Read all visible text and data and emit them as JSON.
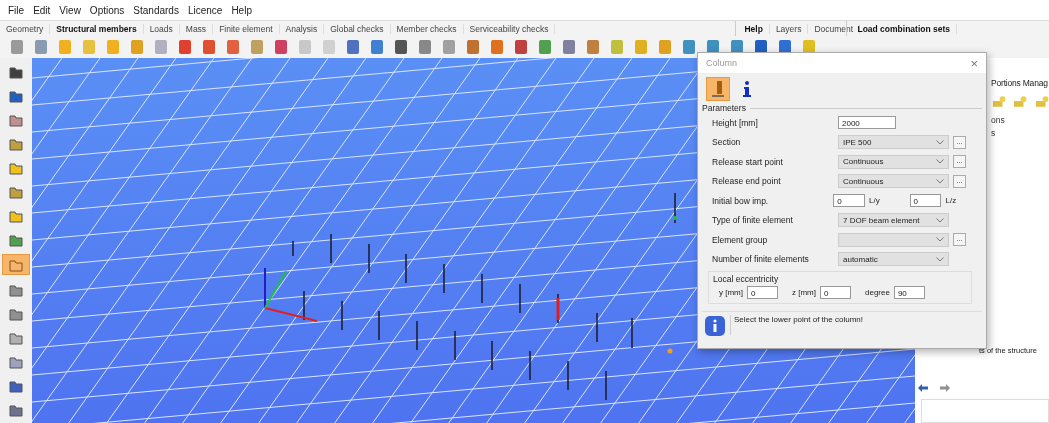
{
  "menu": [
    "File",
    "Edit",
    "View",
    "Options",
    "Standards",
    "Licence",
    "Help"
  ],
  "tabs": [
    {
      "label": "Geometry",
      "selected": false
    },
    {
      "label": "Structural members",
      "selected": true
    },
    {
      "label": "Loads",
      "selected": false
    },
    {
      "label": "Mass",
      "selected": false
    },
    {
      "label": "Finite element",
      "selected": false
    },
    {
      "label": "Analysis",
      "selected": false
    },
    {
      "label": "Global checks",
      "selected": false
    },
    {
      "label": "Member checks",
      "selected": false
    },
    {
      "label": "Serviceability checks",
      "selected": false
    }
  ],
  "help_tabs": [
    {
      "label": "Help",
      "selected": true
    },
    {
      "label": "Layers",
      "selected": false
    },
    {
      "label": "Document",
      "selected": false
    }
  ],
  "combination_tab": {
    "label": "Load combination sets",
    "selected": true
  },
  "left_toolbar": [
    {
      "selected": false
    },
    {
      "selected": false
    },
    {
      "selected": false
    },
    {
      "selected": false
    },
    {
      "selected": false
    },
    {
      "selected": false
    },
    {
      "selected": false
    },
    {
      "selected": false
    },
    {
      "selected": true
    },
    {
      "selected": false
    },
    {
      "selected": false
    },
    {
      "selected": false
    },
    {
      "selected": false
    },
    {
      "selected": false
    },
    {
      "selected": false
    }
  ],
  "right_panel": {
    "title": "Portions Manag",
    "lines": [
      "ons",
      "s"
    ],
    "footer": "ts of the structure"
  },
  "dialog": {
    "title": "Column",
    "close": "×",
    "modes": [
      {
        "kind": "column",
        "selected": true
      },
      {
        "kind": "info",
        "selected": false
      }
    ],
    "group": "Parameters",
    "rows": [
      {
        "kind": "input",
        "label": "Height [mm]",
        "value": "2000"
      },
      {
        "kind": "select",
        "label": "Section",
        "value": "IPE 500",
        "button": "..."
      },
      {
        "kind": "select",
        "label": "Release start point",
        "value": "Continuous",
        "button": "..."
      },
      {
        "kind": "select",
        "label": "Release end point",
        "value": "Continuous",
        "button": "..."
      },
      {
        "kind": "pair",
        "label": "Initial bow imp.",
        "value": "0",
        "unit": "L/y",
        "value2": "0",
        "unit2": "L/z"
      },
      {
        "kind": "select",
        "label": "Type of finite element",
        "value": "7 DOF beam element"
      },
      {
        "kind": "select",
        "label": "Element group",
        "button": "..."
      },
      {
        "kind": "select",
        "label": "Number of finite elements",
        "value": "automatic"
      }
    ],
    "eccentricity": {
      "title": "Local eccentricity",
      "fields": [
        {
          "label": "y [mm]",
          "value": "0"
        },
        {
          "label": "z [mm]",
          "value": "0"
        },
        {
          "label": "degree",
          "value": "90"
        }
      ]
    },
    "message": "Select the lower point of the column!"
  }
}
